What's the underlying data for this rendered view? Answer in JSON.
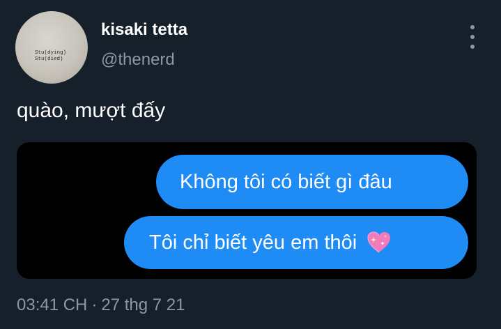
{
  "user": {
    "display_name": "kisaki tetta",
    "handle": "@thenerd",
    "avatar_text_line1": "Stu(dying)",
    "avatar_text_line2": "Stu(died)"
  },
  "tweet": {
    "text": "quào, mượt đấy"
  },
  "media": {
    "messages": [
      {
        "text": "Không tôi có biết gì đâu",
        "bubble_color": "#1f8cf6"
      },
      {
        "text": "Tôi chỉ biết yêu em thôi",
        "emoji": "sparkling-heart-icon",
        "bubble_color": "#1f8cf6"
      }
    ]
  },
  "meta": {
    "time": "03:41 CH",
    "separator": "·",
    "date": "27 thg 7 21"
  },
  "colors": {
    "background": "#15202b",
    "secondary_text": "#8b98a5",
    "bubble": "#1f8cf6"
  }
}
